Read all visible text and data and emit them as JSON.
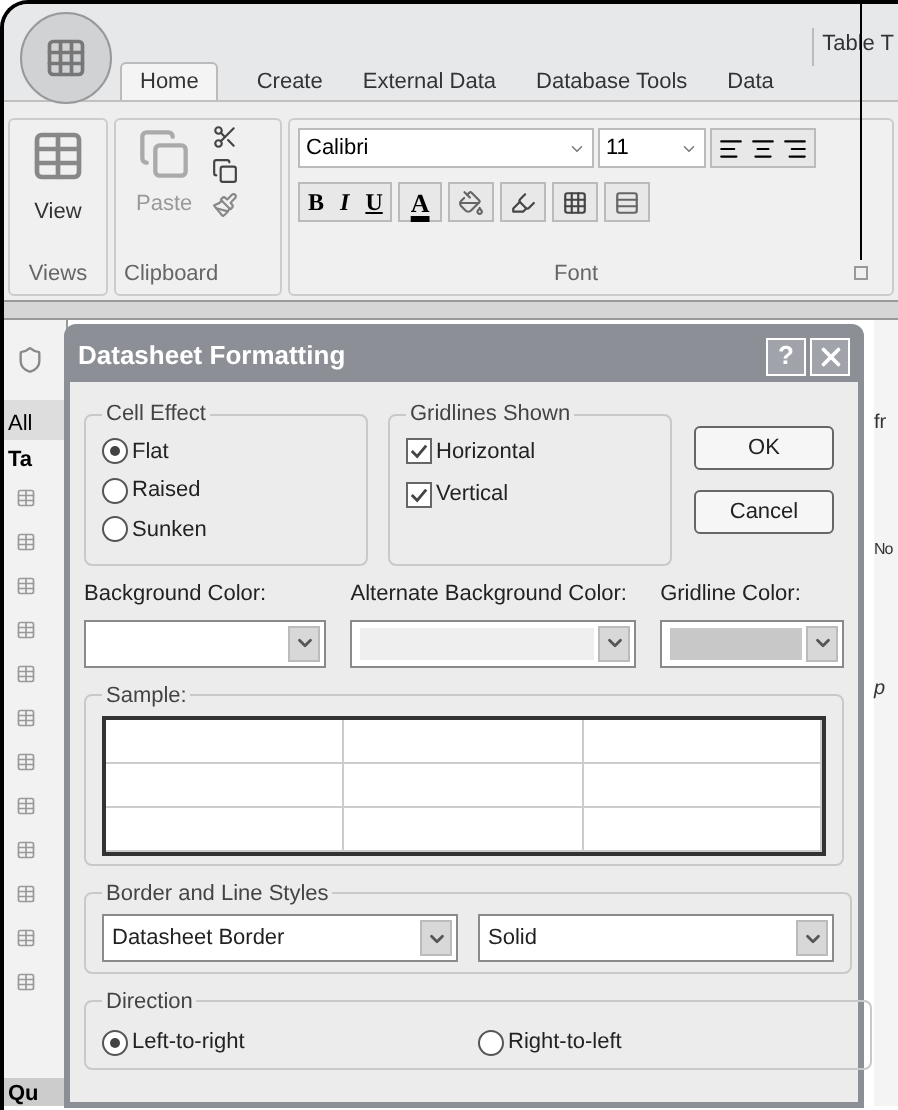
{
  "window": {
    "title": "Table T"
  },
  "tabs": [
    {
      "label": "Home",
      "selected": true
    },
    {
      "label": "Create",
      "selected": false
    },
    {
      "label": "External Data",
      "selected": false
    },
    {
      "label": "Database Tools",
      "selected": false
    },
    {
      "label": "Data",
      "selected": false
    }
  ],
  "ribbon": {
    "views": {
      "button": "View",
      "label": "Views"
    },
    "clipboard": {
      "button": "Paste",
      "label": "Clipboard"
    },
    "font": {
      "font_name": "Calibri",
      "font_size": "11",
      "bold": "B",
      "italic": "I",
      "underline": "U",
      "font_color": "A",
      "label": "Font"
    }
  },
  "navigation": {
    "header": "All",
    "group": "Ta",
    "footer": "Qu"
  },
  "background_right": [
    "fr",
    "No",
    "p"
  ],
  "dialog": {
    "title": "Datasheet Formatting",
    "help": "?",
    "cell_effect": {
      "label": "Cell Effect",
      "options": [
        {
          "label": "Flat",
          "selected": true
        },
        {
          "label": "Raised",
          "selected": false
        },
        {
          "label": "Sunken",
          "selected": false
        }
      ]
    },
    "gridlines": {
      "label": "Gridlines Shown",
      "options": [
        {
          "label": "Horizontal",
          "checked": true
        },
        {
          "label": "Vertical",
          "checked": true
        }
      ]
    },
    "buttons": [
      "OK",
      "Cancel"
    ],
    "colors": [
      {
        "label": "Background Color:"
      },
      {
        "label": "Alternate Background Color:"
      },
      {
        "label": "Gridline Color:"
      }
    ],
    "sample": {
      "label": "Sample:"
    },
    "border_styles": {
      "label": "Border and Line Styles",
      "values": [
        "Datasheet Border",
        "Solid"
      ]
    },
    "direction": {
      "label": "Direction",
      "options": [
        {
          "label": "Left-to-right",
          "selected": true
        },
        {
          "label": "Right-to-left",
          "selected": false
        }
      ]
    }
  }
}
